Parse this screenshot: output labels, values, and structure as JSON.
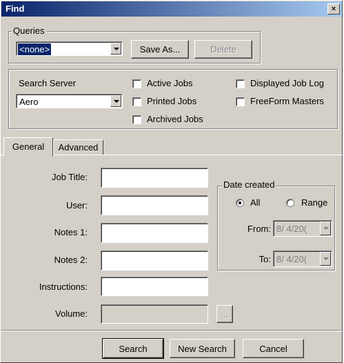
{
  "window": {
    "title": "Find",
    "close_glyph": "×"
  },
  "queries": {
    "group_label": "Queries",
    "selected": "<none>",
    "save_as_label": "Save As...",
    "delete_label": "Delete"
  },
  "server": {
    "label": "Search Server",
    "selected": "Aero",
    "checkboxes": [
      {
        "label": "Active Jobs",
        "checked": false
      },
      {
        "label": "Printed Jobs",
        "checked": false
      },
      {
        "label": "Archived Jobs",
        "checked": false
      },
      {
        "label": "Displayed Job Log",
        "checked": false
      },
      {
        "label": "FreeForm Masters",
        "checked": false
      }
    ]
  },
  "tabs": [
    {
      "label": "General",
      "active": true
    },
    {
      "label": "Advanced",
      "active": false
    }
  ],
  "fields": {
    "job_title": {
      "label": "Job Title:",
      "value": ""
    },
    "user": {
      "label": "User:",
      "value": ""
    },
    "notes1": {
      "label": "Notes 1:",
      "value": ""
    },
    "notes2": {
      "label": "Notes 2:",
      "value": ""
    },
    "instructions": {
      "label": "Instructions:",
      "value": ""
    },
    "volume": {
      "label": "Volume:",
      "value": "",
      "browse_label": "..."
    }
  },
  "date_created": {
    "group_label": "Date created",
    "all_label": "All",
    "range_label": "Range",
    "selected": "All",
    "from_label": "From:",
    "from_value": "8/ 4/20(",
    "to_label": "To:",
    "to_value": "8/ 4/20("
  },
  "footer": {
    "search_label": "Search",
    "new_search_label": "New Search",
    "cancel_label": "Cancel"
  }
}
